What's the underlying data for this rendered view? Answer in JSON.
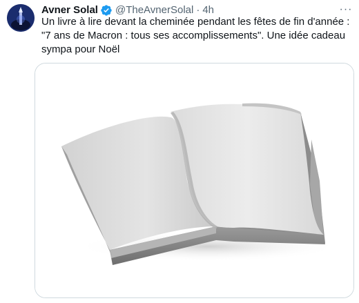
{
  "tweet": {
    "author_name": "Avner Solal",
    "handle": "@TheAvnerSolal",
    "separator": "·",
    "time": "4h",
    "more_label": "···",
    "text": "Un livre à lire devant la cheminée pendant les fêtes de fin d'année : \"7 ans de Macron : tous ses accomplissements\". Une idée cadeau sympa pour Noël",
    "verified": true,
    "accent_color": "#1d9bf0"
  },
  "media": {
    "subject": "open-blank-book-photo"
  }
}
